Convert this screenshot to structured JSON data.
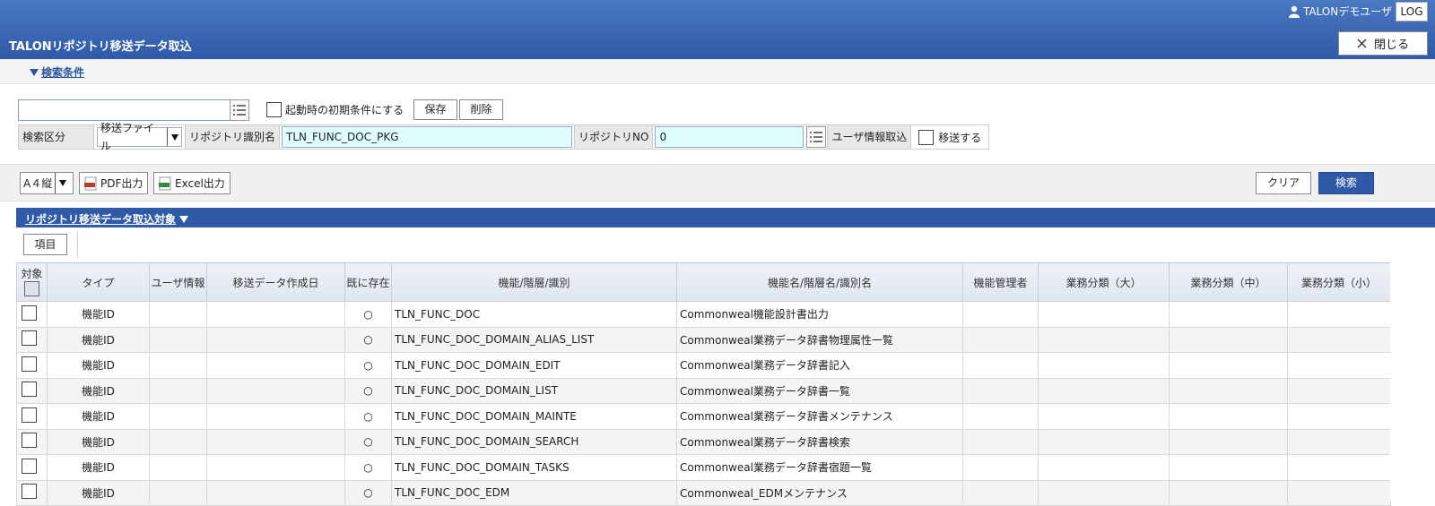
{
  "header": {
    "user_name": "TALONデモユーザ",
    "log_label": "LOG",
    "title": "TALONリポジトリ移送データ取込",
    "close_label": "閉じる"
  },
  "conditions": {
    "toggle_label": "検索条件",
    "search_value": "",
    "init_checkbox_label": "起動時の初期条件にする",
    "save_label": "保存",
    "delete_label": "削除",
    "kubun_label": "検索区分",
    "kubun_value": "移送ファイル",
    "repo_id_label": "リポジトリ識別名",
    "repo_id_value": "TLN_FUNC_DOC_PKG",
    "repo_no_label": "リポジトリNO",
    "repo_no_value": "0",
    "user_info_label": "ユーザ情報取込",
    "transfer_label": "移送する"
  },
  "toolbar": {
    "paper_value": "A４縦",
    "pdf_label": "PDF出力",
    "excel_label": "Excel出力",
    "clear_label": "クリア",
    "search_label": "検索"
  },
  "section": {
    "title": "リポジトリ移送データ取込対象",
    "item_button": "項目"
  },
  "table": {
    "headers": [
      "対象",
      "タイプ",
      "ユーザ情報",
      "移送データ作成日",
      "既に存在",
      "機能/階層/識別",
      "機能名/階層名/識別名",
      "機能管理者",
      "業務分類（大）",
      "業務分類（中）",
      "業務分類（小）"
    ],
    "rows": [
      {
        "type": "機能ID",
        "exists": "○",
        "id": "TLN_FUNC_DOC",
        "name": "Commonweal機能設計書出力"
      },
      {
        "type": "機能ID",
        "exists": "○",
        "id": "TLN_FUNC_DOC_DOMAIN_ALIAS_LIST",
        "name": "Commonweal業務データ辞書物理属性一覧"
      },
      {
        "type": "機能ID",
        "exists": "○",
        "id": "TLN_FUNC_DOC_DOMAIN_EDIT",
        "name": "Commonweal業務データ辞書記入"
      },
      {
        "type": "機能ID",
        "exists": "○",
        "id": "TLN_FUNC_DOC_DOMAIN_LIST",
        "name": "Commonweal業務データ辞書一覧"
      },
      {
        "type": "機能ID",
        "exists": "○",
        "id": "TLN_FUNC_DOC_DOMAIN_MAINTE",
        "name": "Commonweal業務データ辞書メンテナンス"
      },
      {
        "type": "機能ID",
        "exists": "○",
        "id": "TLN_FUNC_DOC_DOMAIN_SEARCH",
        "name": "Commonweal業務データ辞書検索"
      },
      {
        "type": "機能ID",
        "exists": "○",
        "id": "TLN_FUNC_DOC_DOMAIN_TASKS",
        "name": "Commonweal業務データ辞書宿題一覧"
      },
      {
        "type": "機能ID",
        "exists": "○",
        "id": "TLN_FUNC_DOC_EDM",
        "name": "Commonweal_EDMメンテナンス"
      }
    ]
  },
  "colors": {
    "header_blue": "#2f5aa8",
    "cyan_field": "#dffffe"
  }
}
